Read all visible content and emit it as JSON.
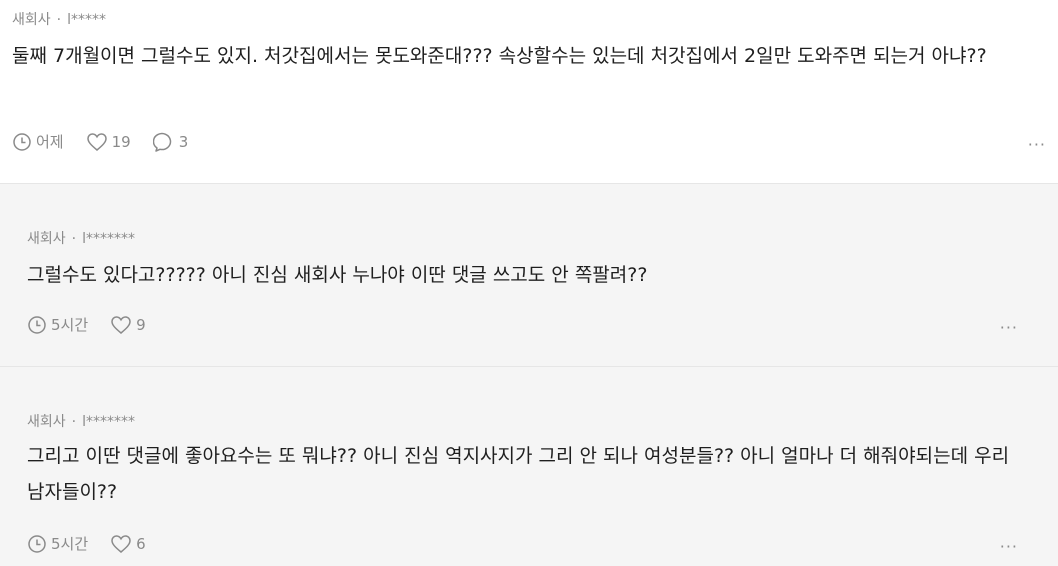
{
  "comments": [
    {
      "author": "새회사",
      "handle": "l*****",
      "text": "둘째 7개월이면 그럴수도 있지. 처갓집에서는 못도와준대??? 속상할수는 있는데 처갓집에서 2일만 도와주면 되는거 아냐??",
      "time": "어제",
      "likes": "19",
      "replies": "3"
    },
    {
      "author": "새회사",
      "handle": "l*******",
      "text": "그럴수도 있다고????? 아니 진심 새회사 누나야 이딴 댓글 쓰고도 안 쪽팔려??",
      "time": "5시간",
      "likes": "9"
    },
    {
      "author": "새회사",
      "handle": "l*******",
      "text": "그리고 이딴 댓글에 좋아요수는 또 뭐냐?? 아니 진심 역지사지가 그리 안 되나 여성분들?? 아니 얼마나 더 해줘야되는데 우리 남자들이??",
      "time": "5시간",
      "likes": "6"
    }
  ],
  "more_glyph": "···",
  "separator": "·"
}
